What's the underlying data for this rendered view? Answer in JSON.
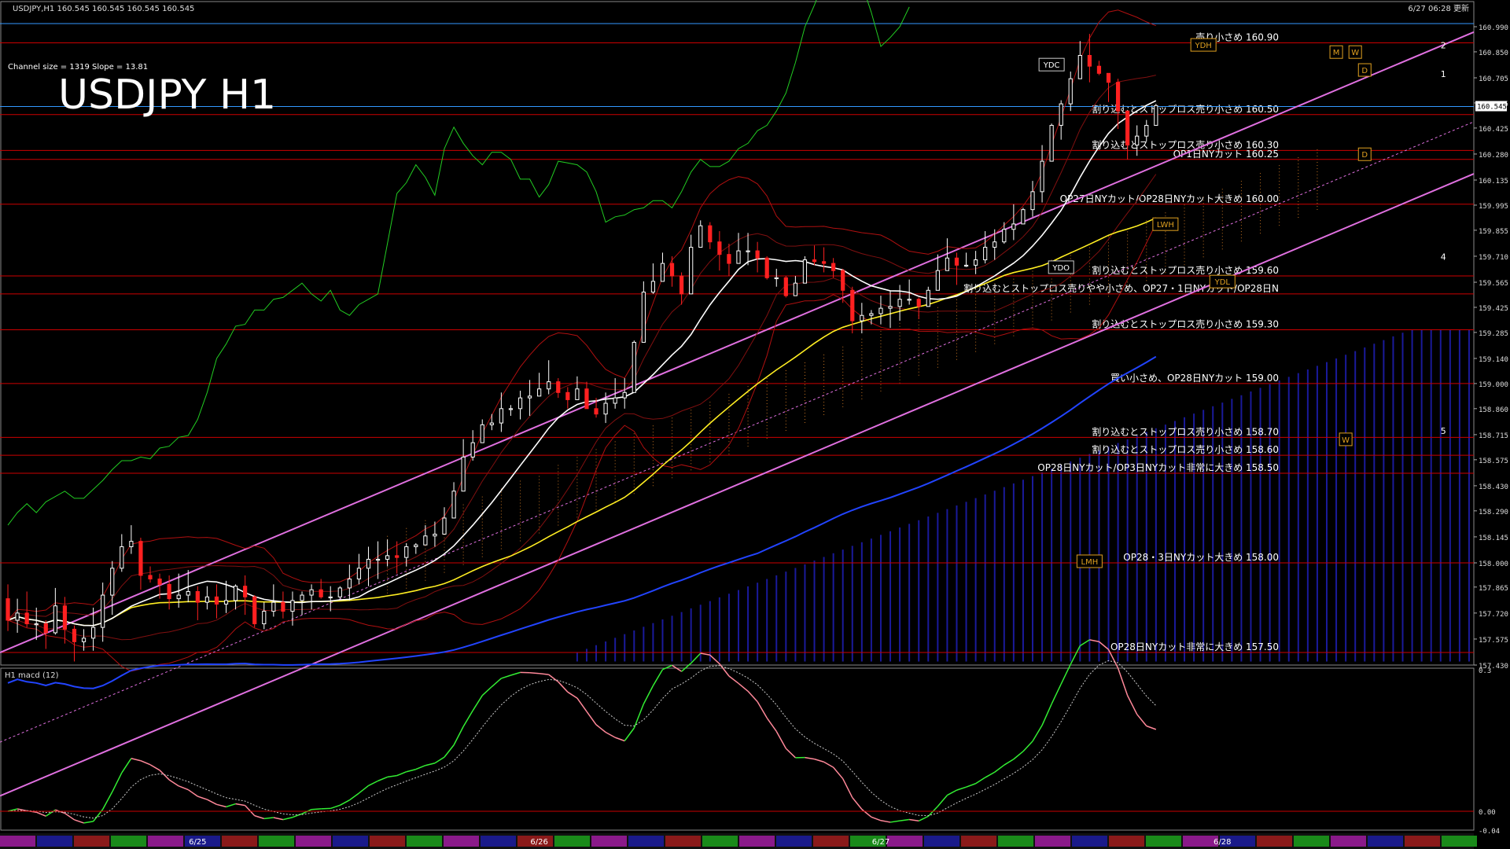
{
  "header": {
    "symbol_info": "USDJPY,H1  160.545 160.545 160.545 160.545",
    "timestamp": "6/27 06:28 更新"
  },
  "chart_title": "USDJPY H1",
  "channel_info": "Channel size = 1319 Slope = 13.81",
  "current_price": "160.545",
  "macd_label": "H1  macd (12)",
  "colors": {
    "background": "#000000",
    "up_candle": "#ffffff",
    "down_candle": "#ff2020",
    "level_line": "#cc0000",
    "channel": "#e070e0",
    "kumo": "#1a1a9a",
    "ma_white": "#ffffff",
    "ma_yellow": "#ffee22",
    "ma_blue": "#2244ff",
    "chikou": "#22cc22",
    "macd_up": "#33ee33",
    "macd_down": "#ff8899"
  },
  "chart_data": {
    "type": "candlestick",
    "symbol": "USDJPY",
    "timeframe": "H1",
    "ylim": [
      157.43,
      160.99
    ],
    "y_ticks": [
      "160.990",
      "160.850",
      "160.705",
      "160.565",
      "160.425",
      "160.280",
      "160.135",
      "159.995",
      "159.855",
      "159.710",
      "159.565",
      "159.425",
      "159.285",
      "159.140",
      "159.000",
      "158.860",
      "158.715",
      "158.575",
      "158.430",
      "158.290",
      "158.145",
      "158.000",
      "157.865",
      "157.720",
      "157.575",
      "157.430"
    ],
    "x_ticks": [
      "6/25",
      "6/26",
      "6/27",
      "6/28"
    ],
    "levels": [
      {
        "price": 160.9,
        "label": "売り小さめ 160.90"
      },
      {
        "price": 160.5,
        "label": "割り込むとストップロス売り小さめ 160.50"
      },
      {
        "price": 160.3,
        "label": "割り込むとストップロス売り小さめ 160.30"
      },
      {
        "price": 160.25,
        "label": "OP1日NYカット 160.25"
      },
      {
        "price": 160.0,
        "label": "OP27日NYカット/OP28日NYカット大きめ 160.00"
      },
      {
        "price": 159.6,
        "label": "割り込むとストップロス売り小さめ 159.60"
      },
      {
        "price": 159.5,
        "label": "割り込むとストップロス売りやや小さめ、OP27・1日NYカット/OP28日N"
      },
      {
        "price": 159.3,
        "label": "割り込むとストップロス売り小さめ 159.30"
      },
      {
        "price": 159.0,
        "label": "買い小さめ、OP28日NYカット 159.00"
      },
      {
        "price": 158.7,
        "label": "割り込むとストップロス売り小さめ 158.70"
      },
      {
        "price": 158.6,
        "label": "割り込むとストップロス売り小さめ 158.60"
      },
      {
        "price": 158.5,
        "label": "OP28日NYカット/OP3日NYカット非常に大きめ 158.50"
      },
      {
        "price": 158.0,
        "label": "OP28・3日NYカット大きめ 158.00"
      },
      {
        "price": 157.5,
        "label": "OP28日NYカット非常に大きめ 157.50"
      }
    ],
    "markers": [
      {
        "text": "YDH",
        "price": 160.88,
        "t": 126
      },
      {
        "text": "YDC",
        "price": 160.77,
        "t": 110
      },
      {
        "text": "LWH",
        "price": 159.88,
        "t": 122
      },
      {
        "text": "YDO",
        "price": 159.64,
        "t": 111
      },
      {
        "text": "YDL",
        "price": 159.56,
        "t": 128
      },
      {
        "text": "LMH",
        "price": 158.0,
        "t": 114
      },
      {
        "text": "M",
        "price": 160.84,
        "t": 140
      },
      {
        "text": "W",
        "price": 160.84,
        "t": 142
      },
      {
        "text": "D",
        "price": 160.74,
        "t": 143
      },
      {
        "text": "W",
        "price": 158.68,
        "t": 141
      },
      {
        "text": "D",
        "price": 160.27,
        "t": 143
      }
    ],
    "fan_labels": [
      {
        "text": "2",
        "price": 160.87,
        "t": 151
      },
      {
        "text": "1",
        "price": 160.71,
        "t": 151
      },
      {
        "text": "4",
        "price": 159.69,
        "t": 151
      },
      {
        "text": "5",
        "price": 158.72,
        "t": 151
      }
    ],
    "candles": [
      [
        157.8,
        157.68,
        157.88,
        157.62
      ],
      [
        157.68,
        157.72,
        157.8,
        157.61
      ],
      [
        157.72,
        157.66,
        157.84,
        157.64
      ],
      [
        157.66,
        157.66,
        157.75,
        157.57
      ],
      [
        157.66,
        157.61,
        157.68,
        157.52
      ],
      [
        157.61,
        157.76,
        157.86,
        157.6
      ],
      [
        157.76,
        157.63,
        157.81,
        157.55
      ],
      [
        157.63,
        157.56,
        157.65,
        157.45
      ],
      [
        157.56,
        157.58,
        157.63,
        157.51
      ],
      [
        157.58,
        157.64,
        157.75,
        157.51
      ],
      [
        157.64,
        157.82,
        157.89,
        157.56
      ],
      [
        157.82,
        157.97,
        158.01,
        157.71
      ],
      [
        157.97,
        158.09,
        158.16,
        157.95
      ],
      [
        158.09,
        158.12,
        158.21,
        158.05
      ],
      [
        158.12,
        157.93,
        158.14,
        157.85
      ],
      [
        157.93,
        157.91,
        157.98,
        157.89
      ],
      [
        157.91,
        157.88,
        157.94,
        157.8
      ],
      [
        157.88,
        157.8,
        157.93,
        157.74
      ],
      [
        157.8,
        157.82,
        157.94,
        157.75
      ],
      [
        157.82,
        157.84,
        157.96,
        157.78
      ],
      [
        157.84,
        157.78,
        157.87,
        157.68
      ],
      [
        157.78,
        157.81,
        157.87,
        157.74
      ],
      [
        157.81,
        157.77,
        157.88,
        157.69
      ],
      [
        157.77,
        157.79,
        157.9,
        157.72
      ],
      [
        157.79,
        157.87,
        157.88,
        157.74
      ],
      [
        157.87,
        157.81,
        157.93,
        157.71
      ],
      [
        157.81,
        157.66,
        157.82,
        157.64
      ],
      [
        157.66,
        157.73,
        157.78,
        157.63
      ],
      [
        157.73,
        157.78,
        157.88,
        157.7
      ],
      [
        157.78,
        157.73,
        157.84,
        157.69
      ],
      [
        157.73,
        157.79,
        157.84,
        157.65
      ],
      [
        157.79,
        157.82,
        157.84,
        157.71
      ],
      [
        157.82,
        157.85,
        157.88,
        157.74
      ],
      [
        157.85,
        157.81,
        157.91,
        157.8
      ],
      [
        157.81,
        157.81,
        157.87,
        157.73
      ],
      [
        157.81,
        157.86,
        157.87,
        157.8
      ],
      [
        157.86,
        157.91,
        157.99,
        157.79
      ],
      [
        157.91,
        157.97,
        158.05,
        157.88
      ],
      [
        157.97,
        158.02,
        158.09,
        157.87
      ],
      [
        158.02,
        158.02,
        158.12,
        157.91
      ],
      [
        158.02,
        158.04,
        158.13,
        157.98
      ],
      [
        158.04,
        158.03,
        158.12,
        157.94
      ],
      [
        158.03,
        158.09,
        158.11,
        157.98
      ],
      [
        158.09,
        158.1,
        158.11,
        158.05
      ],
      [
        158.1,
        158.15,
        158.21,
        158.12
      ],
      [
        158.15,
        158.16,
        158.23,
        158.09
      ],
      [
        158.16,
        158.25,
        158.31,
        158.2
      ],
      [
        158.25,
        158.4,
        158.45,
        158.31
      ],
      [
        158.4,
        158.59,
        158.69,
        158.51
      ],
      [
        158.59,
        158.67,
        158.74,
        158.57
      ],
      [
        158.67,
        158.77,
        158.8,
        158.72
      ],
      [
        158.77,
        158.78,
        158.83,
        158.74
      ],
      [
        158.78,
        158.86,
        158.95,
        158.73
      ],
      [
        158.86,
        158.86,
        158.88,
        158.82
      ],
      [
        158.86,
        158.92,
        158.96,
        158.8
      ],
      [
        158.92,
        158.93,
        159.02,
        158.82
      ],
      [
        158.93,
        158.97,
        159.06,
        158.95
      ],
      [
        158.97,
        159.01,
        159.13,
        158.94
      ],
      [
        159.01,
        158.95,
        159.03,
        158.92
      ],
      [
        158.95,
        158.91,
        158.98,
        158.86
      ],
      [
        158.91,
        158.97,
        159.04,
        158.93
      ],
      [
        158.97,
        158.86,
        159.01,
        158.86
      ],
      [
        158.86,
        158.83,
        158.92,
        158.81
      ],
      [
        158.83,
        158.89,
        158.95,
        158.78
      ],
      [
        158.89,
        158.92,
        159.03,
        158.86
      ],
      [
        158.92,
        158.95,
        159.03,
        158.86
      ],
      [
        158.95,
        159.23,
        159.24,
        158.96
      ],
      [
        159.23,
        159.51,
        159.57,
        159.34
      ],
      [
        159.51,
        159.57,
        159.67,
        159.5
      ],
      [
        159.57,
        159.67,
        159.73,
        159.67
      ],
      [
        159.67,
        159.6,
        159.71,
        159.54
      ],
      [
        159.6,
        159.5,
        159.62,
        159.44
      ],
      [
        159.5,
        159.76,
        159.83,
        159.56
      ],
      [
        159.76,
        159.88,
        159.91,
        159.8
      ],
      [
        159.88,
        159.79,
        159.9,
        159.75
      ],
      [
        159.79,
        159.72,
        159.85,
        159.63
      ],
      [
        159.72,
        159.67,
        159.78,
        159.6
      ],
      [
        159.67,
        159.74,
        159.84,
        159.71
      ],
      [
        159.74,
        159.74,
        159.84,
        159.66
      ],
      [
        159.74,
        159.7,
        159.79,
        159.62
      ],
      [
        159.7,
        159.59,
        159.71,
        159.58
      ],
      [
        159.59,
        159.59,
        159.64,
        159.54
      ],
      [
        159.59,
        159.49,
        159.6,
        159.48
      ],
      [
        159.49,
        159.56,
        159.6,
        159.5
      ],
      [
        159.56,
        159.69,
        159.71,
        159.57
      ],
      [
        159.69,
        159.68,
        159.77,
        159.66
      ],
      [
        159.68,
        159.67,
        159.76,
        159.62
      ],
      [
        159.67,
        159.63,
        159.7,
        159.59
      ],
      [
        159.63,
        159.52,
        159.64,
        159.45
      ],
      [
        159.52,
        159.35,
        159.54,
        159.28
      ],
      [
        159.35,
        159.38,
        159.45,
        159.28
      ],
      [
        159.38,
        159.39,
        159.41,
        159.33
      ],
      [
        159.39,
        159.42,
        159.49,
        159.33
      ],
      [
        159.42,
        159.43,
        159.52,
        159.31
      ],
      [
        159.43,
        159.47,
        159.55,
        159.35
      ],
      [
        159.47,
        159.47,
        159.58,
        159.44
      ],
      [
        159.47,
        159.43,
        159.48,
        159.36
      ],
      [
        159.43,
        159.52,
        159.54,
        159.46
      ],
      [
        159.52,
        159.63,
        159.72,
        159.53
      ],
      [
        159.63,
        159.7,
        159.81,
        159.64
      ],
      [
        159.7,
        159.66,
        159.73,
        159.55
      ],
      [
        159.66,
        159.66,
        159.73,
        159.65
      ],
      [
        159.66,
        159.69,
        159.74,
        159.61
      ],
      [
        159.69,
        159.76,
        159.85,
        159.67
      ],
      [
        159.76,
        159.79,
        159.86,
        159.69
      ],
      [
        159.79,
        159.86,
        159.9,
        159.78
      ],
      [
        159.86,
        159.89,
        160.0,
        159.8
      ],
      [
        159.89,
        159.97,
        159.98,
        159.9
      ],
      [
        159.97,
        160.07,
        160.13,
        159.93
      ],
      [
        160.07,
        160.24,
        160.33,
        160.01
      ],
      [
        160.24,
        160.44,
        160.45,
        160.34
      ],
      [
        160.44,
        160.56,
        160.58,
        160.36
      ],
      [
        160.56,
        160.7,
        160.74,
        160.52
      ],
      [
        160.7,
        160.83,
        160.91,
        160.73
      ],
      [
        160.83,
        160.77,
        160.95,
        160.68
      ],
      [
        160.77,
        160.73,
        160.8,
        160.72
      ],
      [
        160.73,
        160.68,
        160.72,
        160.57
      ],
      [
        160.68,
        160.52,
        160.7,
        160.42
      ],
      [
        160.52,
        160.33,
        160.51,
        160.25
      ],
      [
        160.33,
        160.38,
        160.44,
        160.27
      ],
      [
        160.38,
        160.44,
        160.47,
        160.35
      ],
      [
        160.44,
        160.55,
        160.56,
        160.44
      ]
    ],
    "macd_ylim": [
      -0.04,
      0.3
    ],
    "macd_ticks": [
      "0.3",
      "0.00",
      "-0.04"
    ]
  }
}
